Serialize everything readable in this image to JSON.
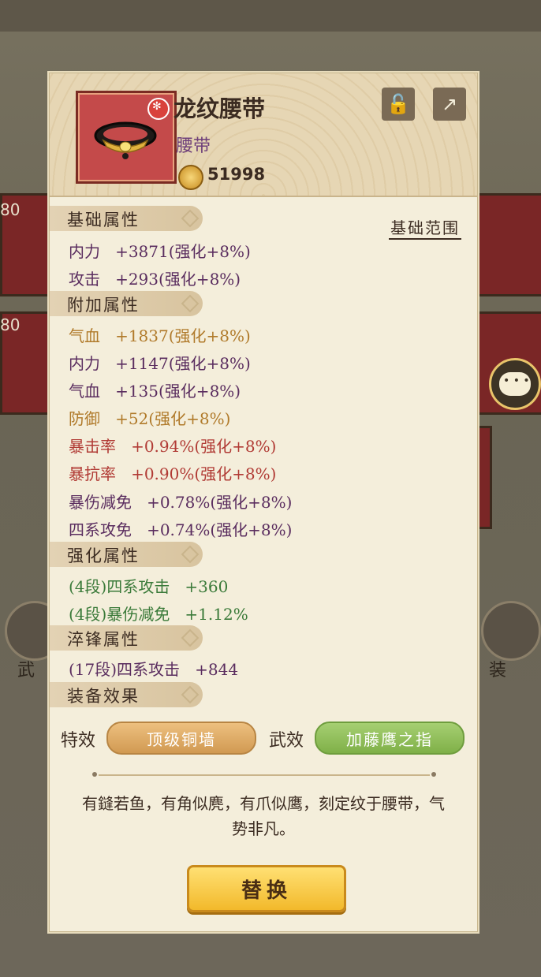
{
  "item": {
    "name": "龙纹腰带",
    "type": "腰带",
    "price": "51998"
  },
  "range_button": "基础范围",
  "sections": {
    "base": "基础属性",
    "extra": "附加属性",
    "enhance": "强化属性",
    "temper": "淬锋属性",
    "effect": "装备效果"
  },
  "base_attrs": [
    {
      "name": "内力",
      "value": "+3871(强化+8%)"
    },
    {
      "name": "攻击",
      "value": "+293(强化+8%)"
    }
  ],
  "extra_attrs": [
    {
      "name": "气血",
      "value": "+1837(强化+8%)"
    },
    {
      "name": "内力",
      "value": "+1147(强化+8%)"
    },
    {
      "name": "气血",
      "value": "+135(强化+8%)"
    },
    {
      "name": "防御",
      "value": "+52(强化+8%)"
    },
    {
      "name": "暴击率",
      "value": "+0.94%(强化+8%)"
    },
    {
      "name": "暴抗率",
      "value": "+0.90%(强化+8%)"
    },
    {
      "name": "暴伤减免",
      "value": "+0.78%(强化+8%)"
    },
    {
      "name": "四系攻免",
      "value": "+0.74%(强化+8%)"
    }
  ],
  "enhance_attrs": [
    {
      "name": "(4段)四系攻击",
      "value": "+360"
    },
    {
      "name": "(4段)暴伤减免",
      "value": "+1.12%"
    }
  ],
  "temper_attrs": [
    {
      "name": "(17段)四系攻击",
      "value": "+844"
    }
  ],
  "effects": {
    "special_label": "特效",
    "special_value": "顶级铜墙",
    "martial_label": "武效",
    "martial_value": "加藤鹰之指"
  },
  "description": "有鏠若鱼，有角似麂，有爪似鹰，刻定纹于腰带，气势非凡。",
  "replace_button": "替换",
  "background": {
    "levels": [
      "80",
      "80"
    ],
    "left_label": "武",
    "right_label": "装"
  }
}
